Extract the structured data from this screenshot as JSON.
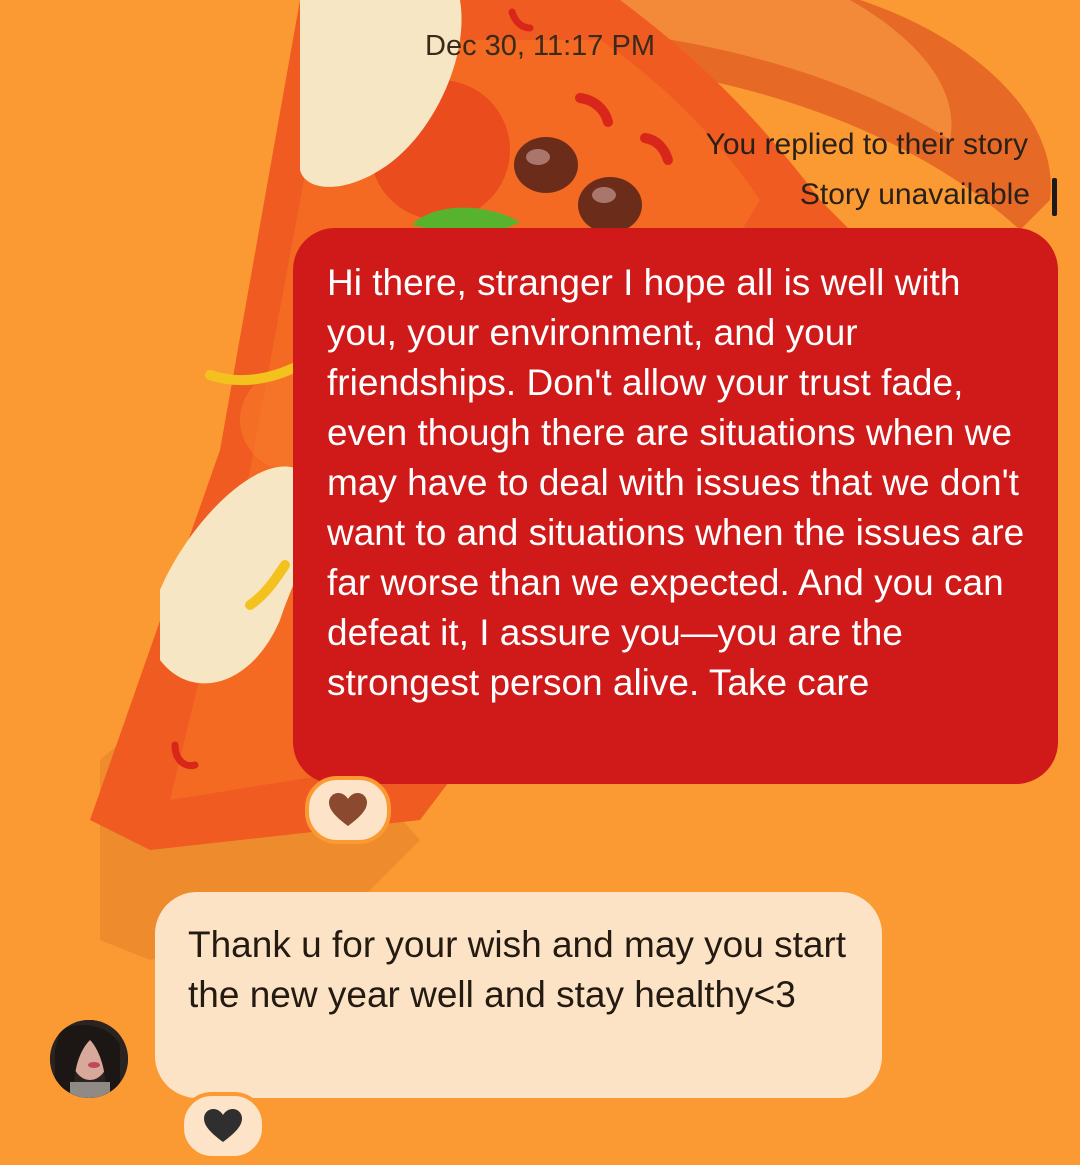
{
  "header": {
    "timestamp": "Dec 30, 11:17 PM"
  },
  "story_reply": {
    "note": "You replied to their story",
    "story_status": "Story unavailable"
  },
  "messages": [
    {
      "direction": "outgoing",
      "text": "Hi there, stranger I hope all is well with you, your environment, and your friendships. Don't allow your trust fade, even though there are situations when we may have to deal with issues that we don't want to and situations when the issues are far worse than we expected. And you can defeat it, I assure you—you are the strongest person alive. Take care",
      "reaction": "brown-heart-icon"
    },
    {
      "direction": "incoming",
      "text": "Thank u for your wish and may you start the new year well and stay healthy<3",
      "reaction": "black-heart-icon"
    }
  ],
  "colors": {
    "background": "#fb9a33",
    "outgoing_bubble": "#d01919",
    "incoming_bubble": "#fde3c6",
    "reaction_pill": "#fde3c7"
  }
}
